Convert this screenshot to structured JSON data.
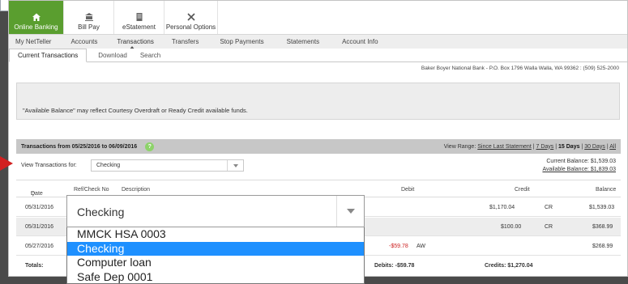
{
  "top_tabs": [
    {
      "label": "Online Banking",
      "icon": "home-icon"
    },
    {
      "label": "Bill Pay",
      "icon": "bank-icon"
    },
    {
      "label": "eStatement",
      "icon": "document-icon"
    },
    {
      "label": "Personal Options",
      "icon": "tools-icon"
    }
  ],
  "sub_nav": [
    "My NetTeller",
    "Accounts",
    "Transactions",
    "Transfers",
    "Stop Payments",
    "Statements",
    "Account Info"
  ],
  "third_nav": [
    "Current Transactions",
    "Download",
    "Search"
  ],
  "bank_address": "Baker Boyer National Bank - P.O. Box 1796 Walla Walla, WA 99362 : (509) 525-2000",
  "notice": "\"Available Balance\" may reflect Courtesy Overdraft or Ready Credit available funds.",
  "tx_bar": {
    "title": "Transactions from 05/25/2016 to 06/09/2016",
    "help": "?",
    "range_label": "View Range:",
    "range_since": "Since Last Statement",
    "range_7": "7 Days",
    "range_15": "15 Days",
    "range_30": "30 Days",
    "range_all": "All"
  },
  "filter": {
    "label": "View Transactions for:",
    "selected": "Checking",
    "current_balance": "Current Balance: $1,539.03",
    "available_balance": "Available Balance: $1,839.03"
  },
  "columns": {
    "date": "Date",
    "ref": "Ref/Check No",
    "desc": "Description",
    "debit": "Debit",
    "credit": "Credit",
    "balance": "Balance"
  },
  "rows": [
    {
      "date": "05/31/2016",
      "debit": "",
      "debit_code": "",
      "credit": "$1,170.04",
      "credit_code": "CR",
      "balance": "$1,539.03"
    },
    {
      "date": "05/31/2016",
      "debit": "",
      "debit_code": "",
      "credit": "$100.00",
      "credit_code": "CR",
      "balance": "$368.99"
    },
    {
      "date": "05/27/2016",
      "debit": "-$59.78",
      "debit_code": "AW",
      "credit": "",
      "credit_code": "",
      "balance": "$268.99"
    }
  ],
  "totals": {
    "label": "Totals:",
    "debits": "Debits: -$59.78",
    "credits": "Credits: $1,270.04"
  },
  "dropdown": {
    "selected": "Checking",
    "options": [
      "MMCK HSA 0003",
      "Checking",
      "Computer loan",
      "Safe Dep 0001"
    ]
  },
  "colors": {
    "accent_green": "#5a9e2f",
    "highlight_blue": "#1e90ff",
    "debit_red": "#cc1f1f"
  }
}
